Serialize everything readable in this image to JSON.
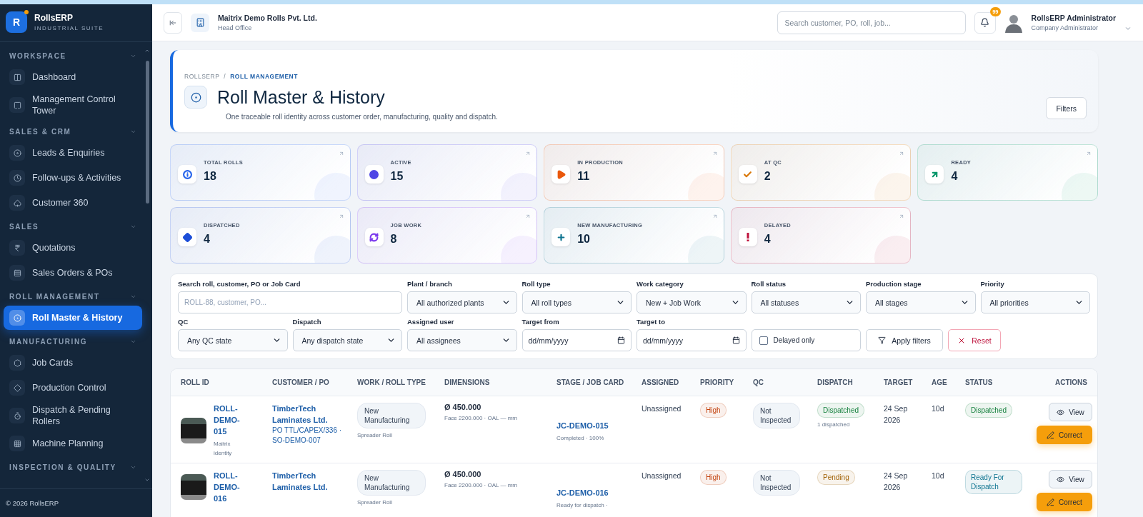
{
  "brand": {
    "initial": "R",
    "name": "RollsERP",
    "tagline": "INDUSTRIAL SUITE"
  },
  "sidebar": {
    "sections": [
      {
        "title": "WORKSPACE",
        "items": [
          {
            "label": "Dashboard",
            "selected": false
          },
          {
            "label": "Management Control Tower",
            "selected": false
          }
        ]
      },
      {
        "title": "SALES & CRM",
        "items": [
          {
            "label": "Leads & Enquiries",
            "selected": false
          },
          {
            "label": "Follow-ups & Activities",
            "selected": false
          },
          {
            "label": "Customer 360",
            "selected": false
          }
        ]
      },
      {
        "title": "SALES",
        "items": [
          {
            "label": "Quotations",
            "selected": false
          },
          {
            "label": "Sales Orders & POs",
            "selected": false
          }
        ]
      },
      {
        "title": "ROLL MANAGEMENT",
        "items": [
          {
            "label": "Roll Master & History",
            "selected": true
          }
        ]
      },
      {
        "title": "MANUFACTURING",
        "items": [
          {
            "label": "Job Cards",
            "selected": false
          },
          {
            "label": "Production Control",
            "selected": false
          },
          {
            "label": "Dispatch & Pending Rollers",
            "selected": false
          },
          {
            "label": "Machine Planning",
            "selected": false
          }
        ]
      },
      {
        "title": "INSPECTION & QUALITY"
      }
    ],
    "footer": "© 2026 RollsERP"
  },
  "topbar": {
    "company": "Maitrix Demo Rolls Pvt. Ltd.",
    "branch": "Head Office",
    "search": {
      "placeholder": "Search customer, PO, roll, job..."
    },
    "notifications": "99",
    "user": {
      "name": "RollsERP Administrator",
      "role": "Company Administrator"
    }
  },
  "page": {
    "breadcrumb": [
      "ROLLSERP",
      "ROLL MANAGEMENT"
    ],
    "breadcrumb_separator": "/",
    "title": "Roll Master & History",
    "subtitle": "One traceable roll identity across customer order, manufacturing, quality and dispatch.",
    "filters_button": "Filters"
  },
  "stats": [
    {
      "label": "TOTAL ROLLS",
      "value": "18",
      "color": "#2563eb"
    },
    {
      "label": "ACTIVE",
      "value": "15",
      "color": "#4f46e5"
    },
    {
      "label": "IN PRODUCTION",
      "value": "11",
      "color": "#ea580c"
    },
    {
      "label": "AT QC",
      "value": "2",
      "color": "#d97706"
    },
    {
      "label": "READY",
      "value": "4",
      "color": "#059669"
    },
    {
      "label": "DISPATCHED",
      "value": "4",
      "color": "#1d4ed8"
    },
    {
      "label": "JOB WORK",
      "value": "8",
      "color": "#7c3aed"
    },
    {
      "label": "NEW MANUFACTURING",
      "value": "10",
      "color": "#0e7490"
    },
    {
      "label": "DELAYED",
      "value": "4",
      "color": "#be123c"
    }
  ],
  "filters": {
    "fields": [
      {
        "kind": "search",
        "label": "Search roll, customer, PO or Job Card",
        "placeholder": "ROLL-88, customer, PO..."
      },
      {
        "kind": "select",
        "label": "Plant / branch",
        "value": "All authorized plants"
      },
      {
        "kind": "select",
        "label": "Roll type",
        "value": "All roll types"
      },
      {
        "kind": "select",
        "label": "Work category",
        "value": "New + Job Work"
      },
      {
        "kind": "select",
        "label": "Roll status",
        "value": "All statuses"
      },
      {
        "kind": "select",
        "label": "Production stage",
        "value": "All stages"
      },
      {
        "kind": "select",
        "label": "Priority",
        "value": "All priorities"
      },
      {
        "kind": "select",
        "label": "QC",
        "value": "Any QC state"
      },
      {
        "kind": "select",
        "label": "Dispatch",
        "value": "Any dispatch state"
      },
      {
        "kind": "select",
        "label": "Assigned user",
        "value": "All assignees"
      },
      {
        "kind": "date",
        "label": "Target from",
        "placeholder": "dd/mm/yyyy"
      },
      {
        "kind": "date",
        "label": "Target to",
        "placeholder": "dd/mm/yyyy"
      },
      {
        "kind": "checkbox",
        "label": "Delayed only",
        "checked": false
      }
    ],
    "apply": "Apply filters",
    "reset": "Reset"
  },
  "table": {
    "columns": [
      "ROLL ID",
      "CUSTOMER / PO",
      "WORK / ROLL TYPE",
      "DIMENSIONS",
      "STAGE / JOB CARD",
      "ASSIGNED",
      "PRIORITY",
      "QC",
      "DISPATCH",
      "TARGET",
      "AGE",
      "STATUS",
      "ACTIONS"
    ],
    "rows": [
      {
        "roll_id": "ROLL-DEMO-015",
        "identity": "Maitrix identity",
        "customer": "TimberTech Laminates Ltd.",
        "po": "PO TTL/CAPEX/336 · SO-DEMO-007",
        "work": "New Manufacturing",
        "roll_type": "Spreader Roll",
        "diameter": "Ø 450.000",
        "dims": "Face 2200.000 · OAL — mm",
        "job_card": "JC-DEMO-015",
        "stage": "Completed · 100%",
        "assigned": "Unassigned",
        "priority": {
          "text": "High",
          "color": "#c2410c"
        },
        "qc": "Not Inspected",
        "dispatch": {
          "text": "Dispatched",
          "color": "#15803d"
        },
        "dispatch_note": "1 dispatched",
        "target": "24 Sep 2026",
        "age": "10d",
        "status": {
          "text": "Dispatched",
          "color": "#15803d"
        },
        "view": "View",
        "correct": "Correct"
      },
      {
        "roll_id": "ROLL-DEMO-016",
        "customer": "TimberTech Laminates Ltd.",
        "work": "New Manufacturing",
        "roll_type": "Spreader Roll",
        "diameter": "Ø 450.000",
        "dims": "Face 2200.000 · OAL — mm",
        "job_card": "JC-DEMO-016",
        "stage": "Ready for dispatch ·",
        "assigned": "Unassigned",
        "priority": {
          "text": "High",
          "color": "#c2410c"
        },
        "qc": "Not Inspected",
        "dispatch": {
          "text": "Pending",
          "color": "#a16207"
        },
        "target": "24 Sep 2026",
        "age": "10d",
        "status": {
          "text": "Ready For Dispatch",
          "color": "#0e7490"
        },
        "view": "View",
        "correct": "Correct"
      }
    ]
  }
}
